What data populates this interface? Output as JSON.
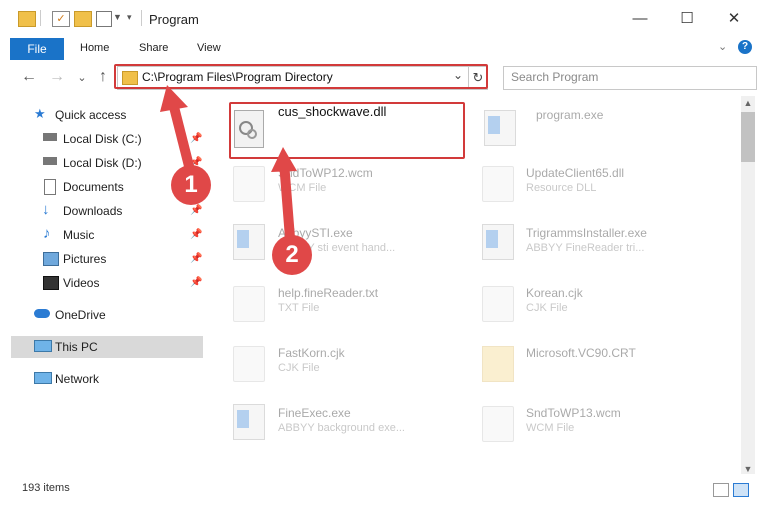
{
  "window": {
    "title": "Program",
    "minimize": "—",
    "maximize": "☐",
    "close": "✕"
  },
  "ribbon": {
    "tabs": [
      "File",
      "Home",
      "Share",
      "View"
    ],
    "expand_icon": "chevron-down-icon",
    "help_icon": "?"
  },
  "nav": {
    "back": "←",
    "forward": "→",
    "recent": "⌄",
    "up": "↑",
    "address": "C:\\Program Files\\Program Directory",
    "dropdown": "⌄",
    "refresh": "↻",
    "search_placeholder": "Search Program"
  },
  "sidebar": {
    "items": [
      {
        "label": "Quick access",
        "icon": "star-icon"
      },
      {
        "label": "Local Disk (C:)",
        "icon": "drive-icon"
      },
      {
        "label": "Local Disk (D:)",
        "icon": "drive-icon"
      },
      {
        "label": "Documents",
        "icon": "documents-icon"
      },
      {
        "label": "Downloads",
        "icon": "download-icon"
      },
      {
        "label": "Music",
        "icon": "music-icon"
      },
      {
        "label": "Pictures",
        "icon": "pictures-icon"
      },
      {
        "label": "Videos",
        "icon": "videos-icon"
      },
      {
        "label": "OneDrive",
        "icon": "cloud-icon"
      },
      {
        "label": "This PC",
        "icon": "computer-icon"
      },
      {
        "label": "Network",
        "icon": "network-icon"
      }
    ]
  },
  "files": {
    "highlighted": {
      "name": "cus_shockwave.dll"
    },
    "items": [
      {
        "name": "program.exe",
        "type": ""
      },
      {
        "name": "SndToWP12.wcm",
        "type": "WCM File"
      },
      {
        "name": "UpdateClient65.dll",
        "type": "Resource DLL"
      },
      {
        "name": "AbbyySTI.exe",
        "type": "ABBYY sti event hand..."
      },
      {
        "name": "TrigrammsInstaller.exe",
        "type": "ABBYY FineReader tri..."
      },
      {
        "name": "help.fineReader.txt",
        "type": "TXT File"
      },
      {
        "name": "Korean.cjk",
        "type": "CJK File"
      },
      {
        "name": "FastKorn.cjk",
        "type": "CJK File"
      },
      {
        "name": "Microsoft.VC90.CRT",
        "type": ""
      },
      {
        "name": "FineExec.exe",
        "type": "ABBYY background exe..."
      },
      {
        "name": "SndToWP13.wcm",
        "type": "WCM File"
      }
    ]
  },
  "status": {
    "count": "193 items"
  },
  "annotations": {
    "step1": "1",
    "step2": "2",
    "color": "#d23a3a"
  }
}
